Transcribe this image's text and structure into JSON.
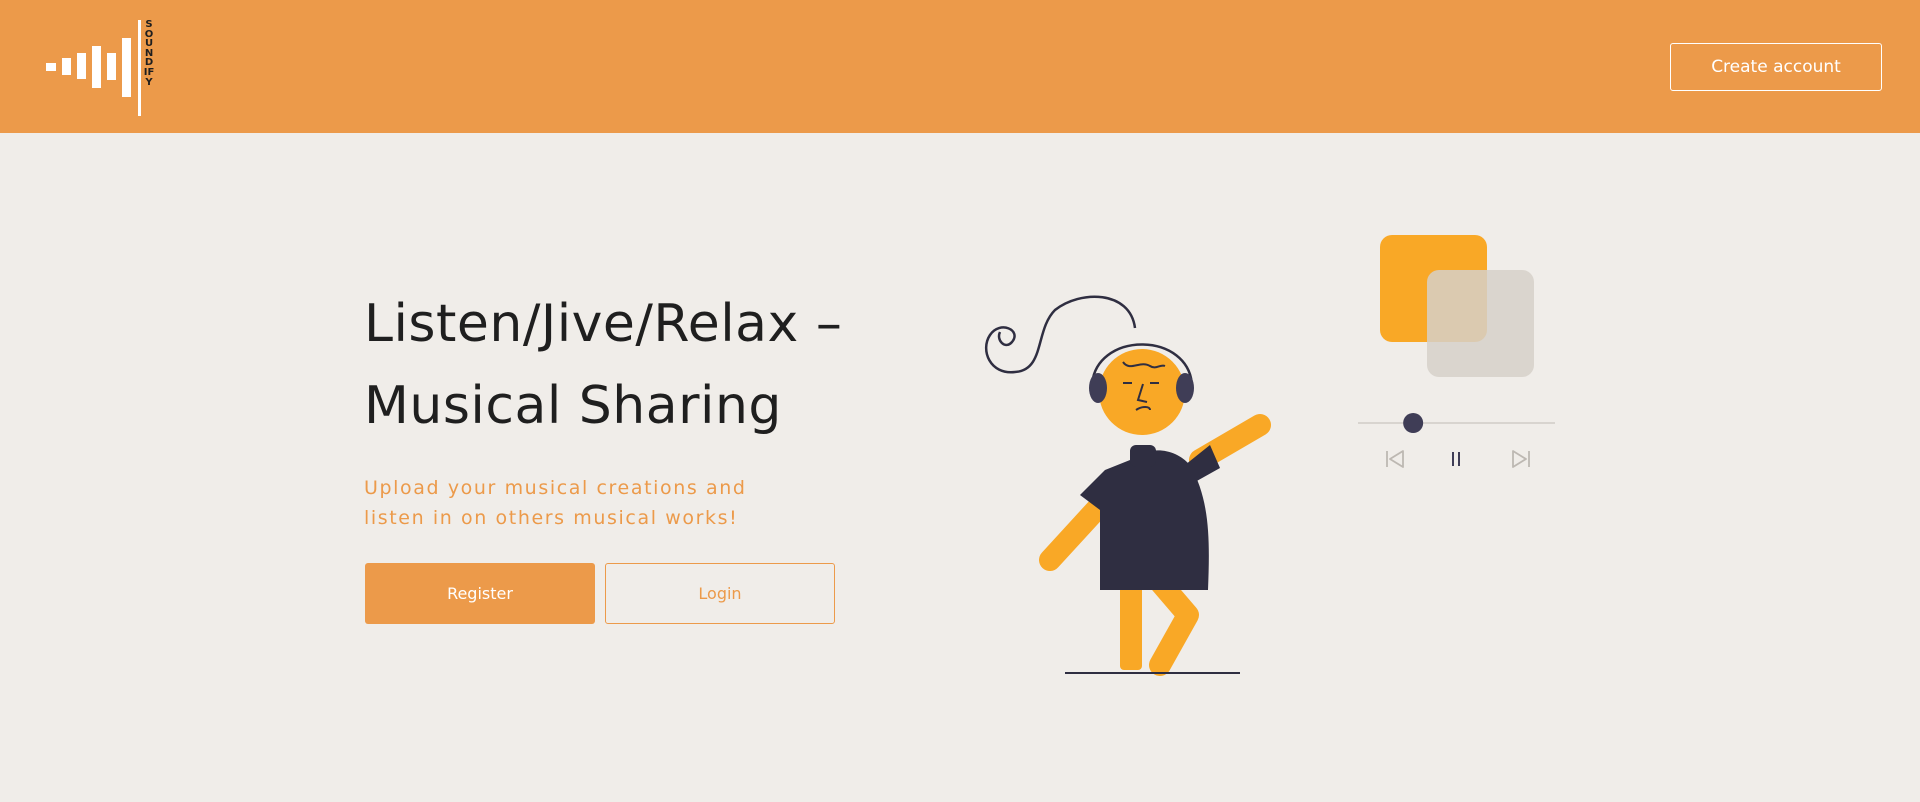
{
  "brand": {
    "name": "SOUNDIFY",
    "logo_icon": "equalizer-bars-icon"
  },
  "header": {
    "create_account_label": "Create account"
  },
  "hero": {
    "title_line1": "Listen/Jive/Relax –",
    "title_line2": "Musical Sharing",
    "subtitle_line1": "Upload your musical creations and",
    "subtitle_line2": "listen in on others musical works!",
    "register_label": "Register",
    "login_label": "Login"
  },
  "player": {
    "progress": 0.28,
    "controls": [
      "previous-icon",
      "pause-icon",
      "next-icon"
    ]
  },
  "colors": {
    "accent": "#ec9a4a",
    "illustration_yellow": "#f9a826",
    "dark": "#2f2e41",
    "background": "#f0ede9"
  }
}
